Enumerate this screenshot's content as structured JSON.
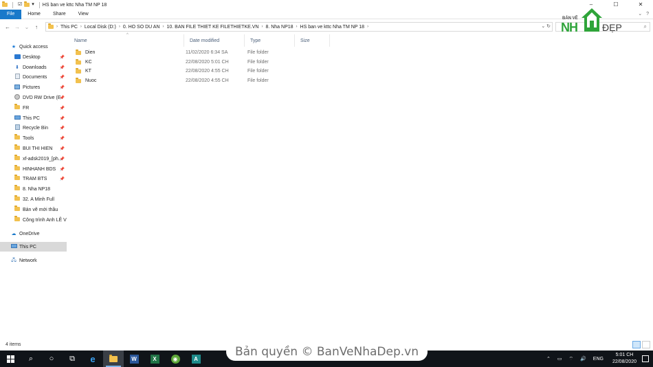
{
  "window": {
    "title": "HS ban ve kttc Nha TM NP 18",
    "controls": [
      "–",
      "☐",
      "✕"
    ]
  },
  "ribbon": {
    "tabs": [
      "File",
      "Home",
      "Share",
      "View"
    ]
  },
  "address": {
    "crumbs": [
      "This PC",
      "Local Disk (D:)",
      "0. HO SO DU AN",
      "10. BAN FILE THIET KE FILETHIETKE.VN",
      "8. Nha NP18",
      "HS ban ve kttc Nha TM NP 18"
    ]
  },
  "logo": {
    "small": "BẢN VẼ",
    "big": "NH",
    "suffix": "ĐẸP"
  },
  "navpane": {
    "items": [
      {
        "label": "Quick access",
        "icon": "star-icon",
        "pinned": false
      },
      {
        "label": "Desktop",
        "icon": "desktop-icon",
        "pinned": true
      },
      {
        "label": "Downloads",
        "icon": "downloads-icon",
        "pinned": true
      },
      {
        "label": "Documents",
        "icon": "documents-icon",
        "pinned": true
      },
      {
        "label": "Pictures",
        "icon": "pictures-icon",
        "pinned": true
      },
      {
        "label": "DVD RW Drive (E",
        "icon": "dvd-icon",
        "pinned": true
      },
      {
        "label": "FR",
        "icon": "folder-icon",
        "pinned": true
      },
      {
        "label": "This PC",
        "icon": "pc-icon",
        "pinned": true
      },
      {
        "label": "Recycle Bin",
        "icon": "recycle-bin-icon",
        "pinned": true
      },
      {
        "label": "Tools",
        "icon": "folder-icon",
        "pinned": true
      },
      {
        "label": "BUI THI HIEN",
        "icon": "folder-icon",
        "pinned": true
      },
      {
        "label": "xf-adsk2019_[ph...",
        "icon": "folder-icon",
        "pinned": true
      },
      {
        "label": "HINHANH BDS",
        "icon": "folder-icon",
        "pinned": true
      },
      {
        "label": "TRAM BTS",
        "icon": "folder-icon",
        "pinned": true
      },
      {
        "label": "8. Nha NP18",
        "icon": "folder-icon",
        "pinned": false
      },
      {
        "label": "32. A Minh Full",
        "icon": "folder-icon",
        "pinned": false
      },
      {
        "label": "Bản vẽ mới thầu",
        "icon": "folder-icon",
        "pinned": false
      },
      {
        "label": "Công trình Anh LÊ V",
        "icon": "folder-icon",
        "pinned": false
      },
      {
        "label": "OneDrive",
        "icon": "onedrive-icon",
        "pinned": false
      },
      {
        "label": "This PC",
        "icon": "pc-icon",
        "pinned": false,
        "selected": true
      },
      {
        "label": "Network",
        "icon": "network-icon",
        "pinned": false
      }
    ]
  },
  "columns": [
    "Name",
    "Date modified",
    "Type",
    "Size"
  ],
  "files": [
    {
      "name": "Dien",
      "date": "11/02/2020 6:34 SA",
      "type": "File folder",
      "size": ""
    },
    {
      "name": "KC",
      "date": "22/08/2020 5:01 CH",
      "type": "File folder",
      "size": ""
    },
    {
      "name": "KT",
      "date": "22/08/2020 4:55 CH",
      "type": "File folder",
      "size": ""
    },
    {
      "name": "Nuoc",
      "date": "22/08/2020 4:55 CH",
      "type": "File folder",
      "size": ""
    }
  ],
  "status": {
    "count": "4 items"
  },
  "watermark": "Bản quyền © BanVeNhaDep.vn",
  "taskbar": {
    "lang": "ENG",
    "time": "5:01 CH",
    "date": "22/08/2020"
  },
  "colors": {
    "accent": "#1979ca",
    "folder": "#f2c14e",
    "taskbar": "#101419",
    "logo_green": "#2fa43a"
  }
}
